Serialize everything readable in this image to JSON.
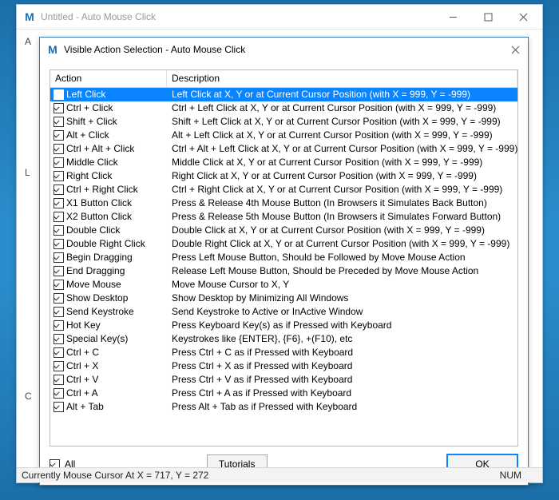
{
  "main_window": {
    "title": "Untitled - Auto Mouse Click"
  },
  "dialog": {
    "title": "Visible Action Selection - Auto Mouse Click",
    "columns": [
      "Action",
      "Description"
    ],
    "rows": [
      {
        "checked": true,
        "selected": true,
        "action": "Left Click",
        "desc": "Left Click at X, Y or at Current Cursor Position (with X = 999, Y = -999)"
      },
      {
        "checked": true,
        "selected": false,
        "action": "Ctrl + Click",
        "desc": "Ctrl + Left Click at X, Y or at Current Cursor Position (with X = 999, Y = -999)"
      },
      {
        "checked": true,
        "selected": false,
        "action": "Shift + Click",
        "desc": "Shift + Left Click at X, Y or at Current Cursor Position (with X = 999, Y = -999)"
      },
      {
        "checked": true,
        "selected": false,
        "action": "Alt + Click",
        "desc": "Alt + Left Click at X, Y or at Current Cursor Position (with X = 999, Y = -999)"
      },
      {
        "checked": true,
        "selected": false,
        "action": "Ctrl + Alt + Click",
        "desc": "Ctrl + Alt + Left Click at X, Y or at Current Cursor Position (with X = 999, Y = -999)"
      },
      {
        "checked": true,
        "selected": false,
        "action": "Middle Click",
        "desc": "Middle Click at X, Y or at Current Cursor Position (with X = 999, Y = -999)"
      },
      {
        "checked": true,
        "selected": false,
        "action": "Right Click",
        "desc": "Right Click at X, Y or at Current Cursor Position (with X = 999, Y = -999)"
      },
      {
        "checked": true,
        "selected": false,
        "action": "Ctrl + Right Click",
        "desc": "Ctrl + Right Click at X, Y or at Current Cursor Position (with X = 999, Y = -999)"
      },
      {
        "checked": true,
        "selected": false,
        "action": "X1 Button Click",
        "desc": "Press & Release 4th Mouse Button (In Browsers it Simulates Back Button)"
      },
      {
        "checked": true,
        "selected": false,
        "action": "X2 Button Click",
        "desc": "Press & Release 5th Mouse Button (In Browsers it Simulates Forward Button)"
      },
      {
        "checked": true,
        "selected": false,
        "action": "Double Click",
        "desc": "Double Click at X, Y or at Current Cursor Position (with X = 999, Y = -999)"
      },
      {
        "checked": true,
        "selected": false,
        "action": "Double Right Click",
        "desc": "Double Right Click at X, Y or at Current Cursor Position (with X = 999, Y = -999)"
      },
      {
        "checked": true,
        "selected": false,
        "action": "Begin Dragging",
        "desc": "Press Left Mouse Button, Should be Followed by Move Mouse Action"
      },
      {
        "checked": true,
        "selected": false,
        "action": "End Dragging",
        "desc": "Release Left Mouse Button, Should be Preceded by Move Mouse Action"
      },
      {
        "checked": true,
        "selected": false,
        "action": "Move Mouse",
        "desc": "Move Mouse Cursor to X, Y"
      },
      {
        "checked": true,
        "selected": false,
        "action": "Show Desktop",
        "desc": "Show Desktop by Minimizing All Windows"
      },
      {
        "checked": true,
        "selected": false,
        "action": "Send Keystroke",
        "desc": "Send Keystroke to Active or InActive Window"
      },
      {
        "checked": true,
        "selected": false,
        "action": "Hot Key",
        "desc": "Press Keyboard Key(s) as if Pressed with Keyboard"
      },
      {
        "checked": true,
        "selected": false,
        "action": "Special Key(s)",
        "desc": "Keystrokes like {ENTER}, {F6}, +(F10), etc"
      },
      {
        "checked": true,
        "selected": false,
        "action": "Ctrl + C",
        "desc": "Press Ctrl + C as if Pressed with Keyboard"
      },
      {
        "checked": true,
        "selected": false,
        "action": "Ctrl + X",
        "desc": "Press Ctrl + X as if Pressed with Keyboard"
      },
      {
        "checked": true,
        "selected": false,
        "action": "Ctrl + V",
        "desc": "Press Ctrl + V as if Pressed with Keyboard"
      },
      {
        "checked": true,
        "selected": false,
        "action": "Ctrl + A",
        "desc": "Press Ctrl + A as if Pressed with Keyboard"
      },
      {
        "checked": true,
        "selected": false,
        "action": "Alt + Tab",
        "desc": "Press Alt + Tab as if Pressed with Keyboard"
      }
    ],
    "all_label": "All",
    "all_checked": true,
    "tutorials_label": "Tutorials",
    "ok_label": "OK"
  },
  "statusbar": {
    "text": "Currently Mouse Cursor At X = 717, Y = 272",
    "num": "NUM"
  }
}
